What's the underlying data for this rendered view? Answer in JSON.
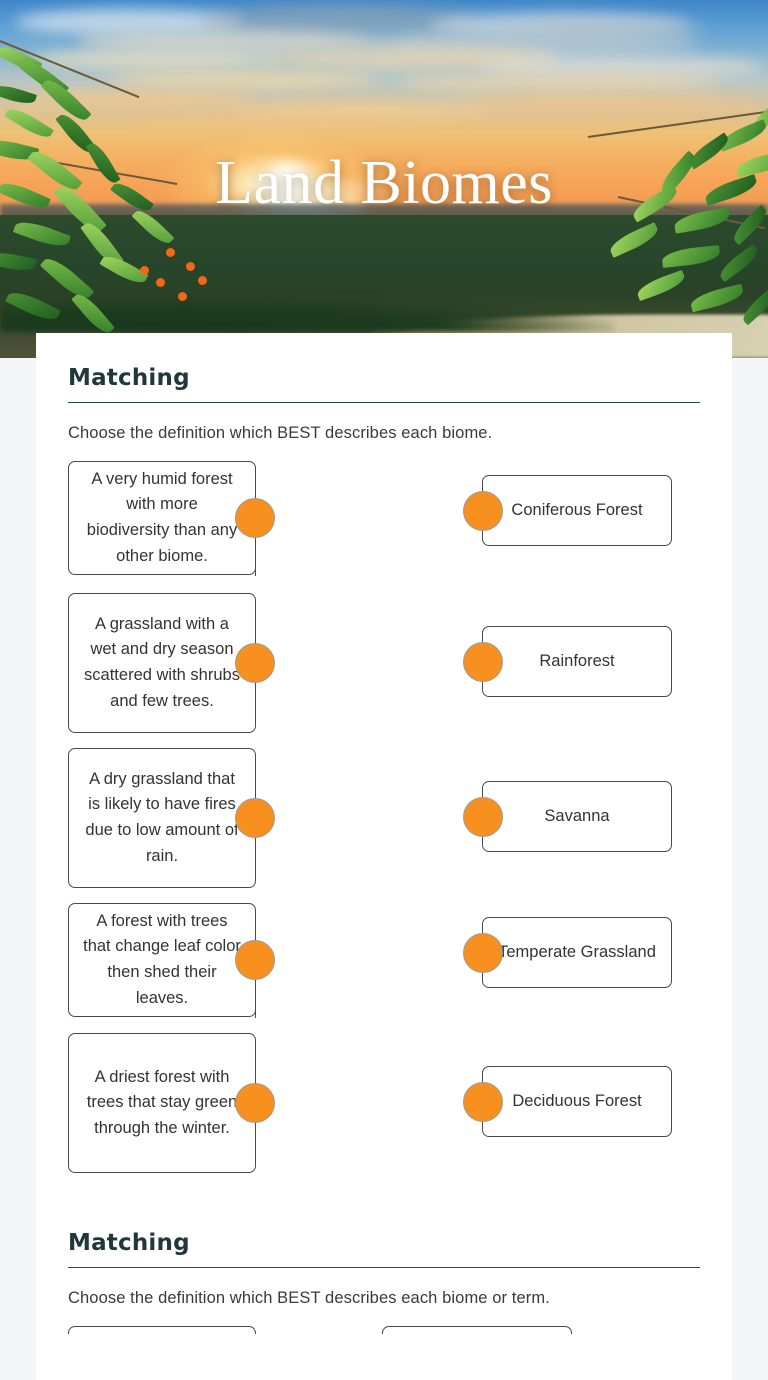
{
  "hero": {
    "title": "Land Biomes",
    "image_alt": "sunset-over-rainforest-river"
  },
  "sections": [
    {
      "title": "Matching",
      "instruction": "Choose the definition which BEST describes each biome.",
      "definitions": [
        "A very humid forest with more biodiversity than any other biome.",
        "A grassland with a wet and dry season scattered with shrubs and few trees.",
        "A dry grassland that is likely to have fires due to low amount of rain.",
        "A forest with trees that change leaf color then shed their leaves.",
        "A driest forest with trees that stay green through the winter."
      ],
      "terms": [
        "Coniferous Forest",
        "Rainforest",
        "Savanna",
        "Temperate Grassland",
        "Deciduous Forest"
      ]
    },
    {
      "title": "Matching",
      "instruction": "Choose the definition which BEST describes each biome or term.",
      "definitions": [],
      "terms": []
    }
  ],
  "colors": {
    "accent_dot": "#f7901e",
    "heading": "#20383b",
    "page_background": "#f4f5f7",
    "card_background": "#ffffff",
    "box_border": "#4a4a4a"
  }
}
